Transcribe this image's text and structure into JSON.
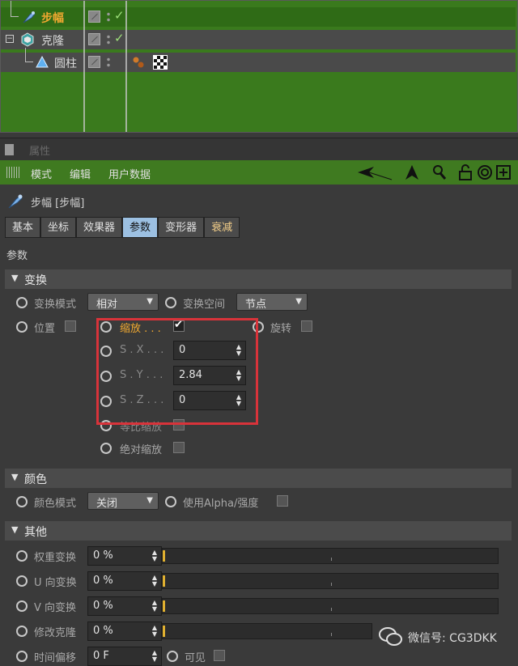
{
  "object_manager": {
    "objects": [
      {
        "name": "步幅",
        "active": true
      },
      {
        "name": "克隆",
        "active": false
      },
      {
        "name": "圆柱",
        "active": false
      }
    ]
  },
  "attribute_manager": {
    "title": "属性",
    "menu": [
      "模式",
      "编辑",
      "用户数据"
    ],
    "object_title": "步幅 [步幅]",
    "tabs": [
      "基本",
      "坐标",
      "效果器",
      "参数",
      "变形器",
      "衰减"
    ],
    "active_tab": "参数",
    "section_label": "参数",
    "groups": {
      "transform": {
        "label": "变换",
        "mode_label": "变换模式",
        "mode_value": "相对",
        "space_label": "变换空间",
        "space_value": "节点",
        "position_label": "位置",
        "scale_label": "缩放 . . .",
        "rotation_label": "旋转",
        "sx_label": "S . X . . .",
        "sx_value": "0",
        "sy_label": "S . Y . . .",
        "sy_value": "2.84",
        "sz_label": "S . Z . . .",
        "sz_value": "0",
        "uniform_label": "等比缩放",
        "absolute_label": "绝对缩放"
      },
      "color": {
        "label": "颜色",
        "mode_label": "颜色模式",
        "mode_value": "关闭",
        "alpha_label": "使用Alpha/强度"
      },
      "other": {
        "label": "其他",
        "rows": [
          {
            "label": "权重变换",
            "value": "0 %"
          },
          {
            "label": "U 向变换",
            "value": "0 %"
          },
          {
            "label": "V 向变换",
            "value": "0 %"
          },
          {
            "label": "修改克隆",
            "value": "0 %"
          },
          {
            "label": "时间偏移",
            "value": "0 F"
          }
        ],
        "visible_label": "可见"
      }
    }
  },
  "watermark": "微信号: CG3DKK",
  "colors": {
    "accent_green": "#3f7a20",
    "highlight_orange": "#f0a830",
    "active_tab": "#9cc0e2",
    "annotation_red": "#d8333a"
  }
}
